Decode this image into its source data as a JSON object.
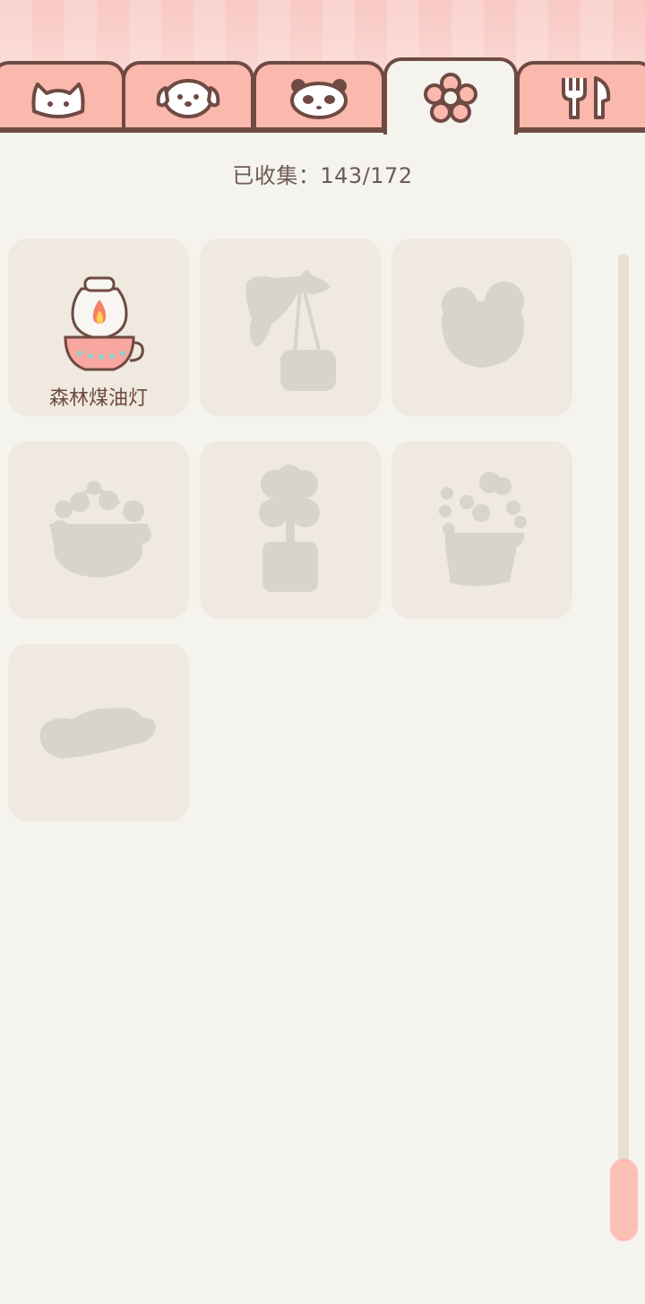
{
  "tabs": [
    {
      "icon": "cat-icon"
    },
    {
      "icon": "dog-icon"
    },
    {
      "icon": "panda-icon"
    },
    {
      "icon": "flower-icon",
      "active": true
    },
    {
      "icon": "utensils-icon"
    }
  ],
  "collection": {
    "label": "已收集：143/172"
  },
  "items": [
    {
      "name": "森林煤油灯",
      "collected": true,
      "icon": "oil-lamp-icon"
    },
    {
      "name": "",
      "collected": false,
      "icon": "hanging-lamp-silhouette-icon"
    },
    {
      "name": "",
      "collected": false,
      "icon": "frog-silhouette-icon"
    },
    {
      "name": "",
      "collected": false,
      "icon": "flower-basket-silhouette-icon"
    },
    {
      "name": "",
      "collected": false,
      "icon": "potted-flower-silhouette-icon"
    },
    {
      "name": "",
      "collected": false,
      "icon": "plant-pot-silhouette-icon"
    },
    {
      "name": "",
      "collected": false,
      "icon": "tray-silhouette-icon"
    }
  ],
  "colors": {
    "tab_fill": "#fbb8ad",
    "tab_outline": "#6e4a43",
    "cell_bg": "#efe9df",
    "silhouette": "#d9d4ca",
    "scroll_thumb": "#fbbfb3"
  },
  "scroll": {
    "position_fraction": 0.95
  }
}
